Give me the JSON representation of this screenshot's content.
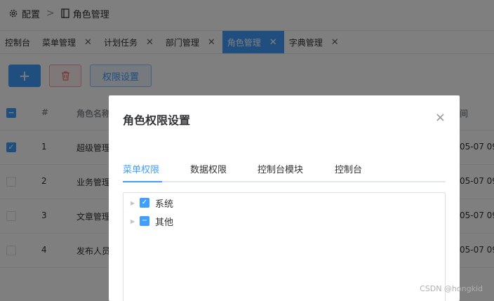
{
  "breadcrumb": {
    "root": "配置",
    "current": "角色管理",
    "separator": ">"
  },
  "tabs": [
    {
      "label": "控制台",
      "closable": false,
      "active": false
    },
    {
      "label": "菜单管理",
      "closable": true,
      "active": false
    },
    {
      "label": "计划任务",
      "closable": true,
      "active": false
    },
    {
      "label": "部门管理",
      "closable": true,
      "active": false
    },
    {
      "label": "角色管理",
      "closable": true,
      "active": true
    },
    {
      "label": "字典管理",
      "closable": true,
      "active": false
    }
  ],
  "toolbar": {
    "add_label": "+",
    "delete_icon": "trash-icon",
    "perm_label": "权限设置"
  },
  "table": {
    "headers": {
      "index": "#",
      "name": "角色名称",
      "time": "间"
    },
    "rows": [
      {
        "checked": true,
        "index": "1",
        "name": "超级管理",
        "time": "05-07 09"
      },
      {
        "checked": false,
        "index": "2",
        "name": "业务管理",
        "time": "05-07 09"
      },
      {
        "checked": false,
        "index": "3",
        "name": "文章管理",
        "time": "05-07 09"
      },
      {
        "checked": false,
        "index": "4",
        "name": "发布人员",
        "time": "05-07 09"
      }
    ]
  },
  "dialog": {
    "title": "角色权限设置",
    "close": "×",
    "tabs": [
      "菜单权限",
      "数据权限",
      "控制台模块",
      "控制台"
    ],
    "active_tab": "菜单权限",
    "tree": [
      {
        "label": "系统",
        "state": "checked"
      },
      {
        "label": "其他",
        "state": "indeterminate"
      }
    ]
  },
  "watermark": "CSDN @hongkid",
  "colors": {
    "primary": "#409eff",
    "danger": "#f56c6c",
    "mask": "rgba(0,0,0,0.5)"
  }
}
